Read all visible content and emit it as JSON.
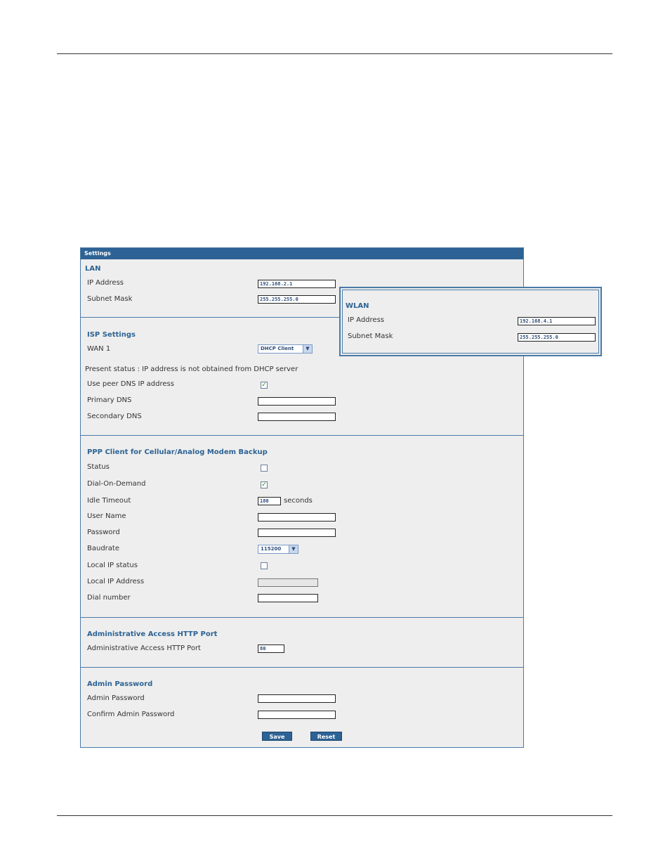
{
  "panel": {
    "header": "Settings",
    "save_label": "Save",
    "reset_label": "Reset"
  },
  "lan": {
    "title": "LAN",
    "ip_label": "IP Address",
    "ip_value": "192.168.2.1",
    "mask_label": "Subnet Mask",
    "mask_value": "255.255.255.0"
  },
  "wlan": {
    "title": "WLAN",
    "ip_label": "IP Address",
    "ip_value": "192.168.4.1",
    "mask_label": "Subnet Mask",
    "mask_value": "255.255.255.0"
  },
  "isp": {
    "title": "ISP Settings",
    "wan_label": "WAN 1",
    "wan_value": "DHCP Client",
    "status_text": "Present status : IP address is not obtained from DHCP server",
    "peer_dns_label": "Use peer DNS IP address",
    "peer_dns_checked": true,
    "primary_dns_label": "Primary DNS",
    "primary_dns_value": "",
    "secondary_dns_label": "Secondary DNS",
    "secondary_dns_value": ""
  },
  "ppp": {
    "title": "PPP Client for Cellular/Analog Modem Backup",
    "status_label": "Status",
    "status_checked": false,
    "dial_on_demand_label": "Dial-On-Demand",
    "dial_on_demand_checked": true,
    "idle_timeout_label": "Idle Timeout",
    "idle_timeout_value": "180",
    "idle_timeout_unit": "seconds",
    "username_label": "User Name",
    "username_value": "",
    "password_label": "Password",
    "password_value": "",
    "baudrate_label": "Baudrate",
    "baudrate_value": "115200",
    "local_ip_status_label": "Local IP status",
    "local_ip_status_checked": false,
    "local_ip_label": "Local IP Address",
    "local_ip_value": "",
    "dial_number_label": "Dial number",
    "dial_number_value": ""
  },
  "http_port": {
    "title": "Administrative Access HTTP Port",
    "label": "Administrative Access HTTP Port",
    "value": "80"
  },
  "admin": {
    "title": "Admin Password",
    "password_label": "Admin Password",
    "password_value": "",
    "confirm_label": "Confirm Admin Password",
    "confirm_value": ""
  },
  "icons": {
    "check": "✓",
    "dropdown_arrow": "▼"
  }
}
